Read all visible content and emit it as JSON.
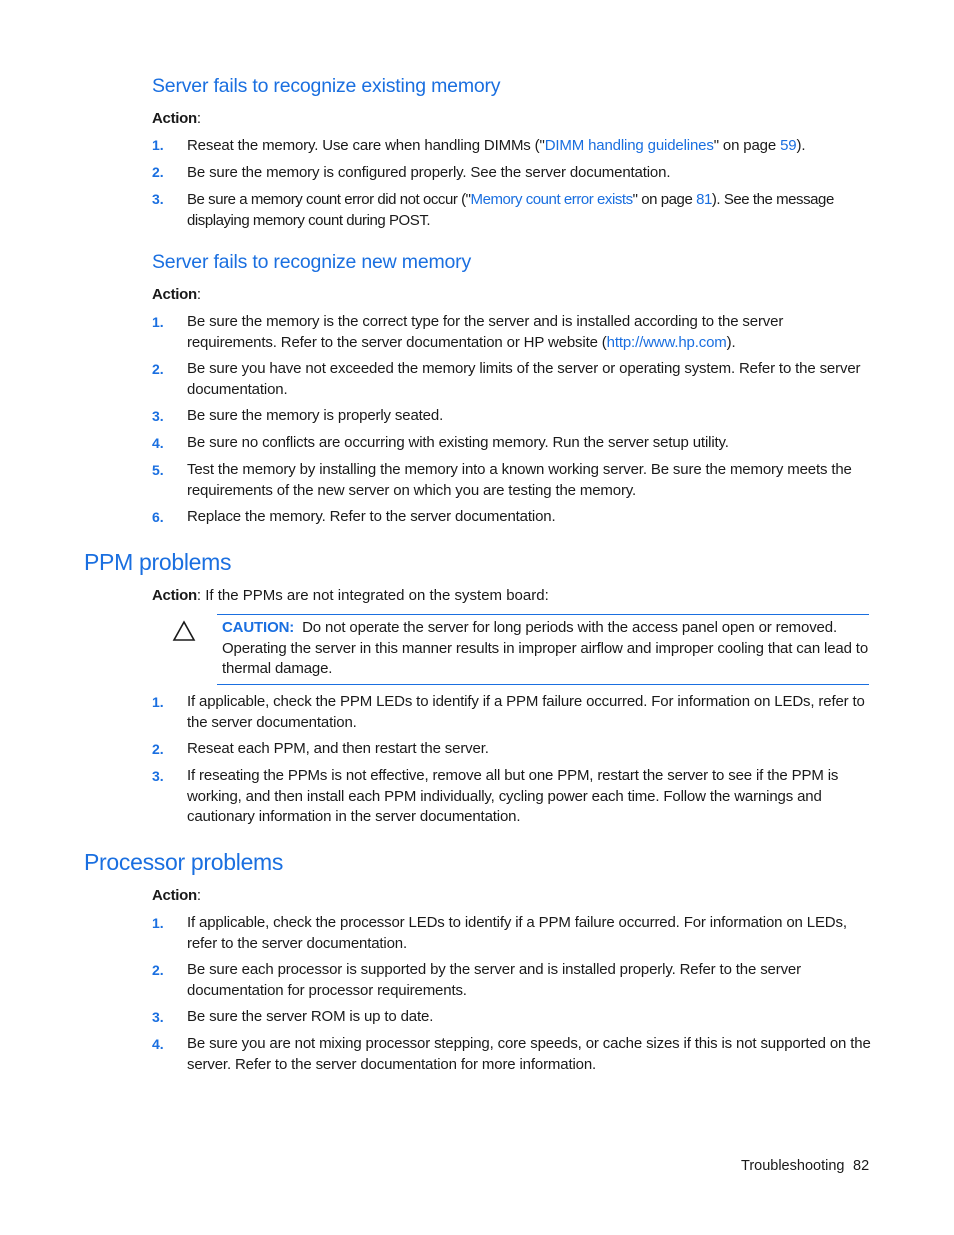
{
  "sections": {
    "existing_memory": {
      "title": "Server fails to recognize existing memory",
      "action_label": "Action",
      "action_suffix": ":",
      "items": [
        {
          "number": "1.",
          "pre": "Reseat the memory. Use care when handling DIMMs (\"",
          "link": "DIMM handling guidelines",
          "mid": "\" on page ",
          "page_link": "59",
          "post": ")."
        },
        {
          "number": "2.",
          "text": "Be sure the memory is configured properly. See the server documentation."
        },
        {
          "number": "3.",
          "pre": "Be sure a memory count error did not occur (\"",
          "link": "Memory count error exists",
          "mid": "\" on page ",
          "page_link": "81",
          "post": "). See the message displaying memory count during POST."
        }
      ]
    },
    "new_memory": {
      "title": "Server fails to recognize new memory",
      "action_label": "Action",
      "action_suffix": ":",
      "items": [
        {
          "number": "1.",
          "pre": "Be sure the memory is the correct type for the server and is installed according to the server requirements. Refer to the server documentation or HP website (",
          "link": "http://www.hp.com",
          "post": ")."
        },
        {
          "number": "2.",
          "text": "Be sure you have not exceeded the memory limits of the server or operating system. Refer to the server documentation."
        },
        {
          "number": "3.",
          "text": "Be sure the memory is properly seated."
        },
        {
          "number": "4.",
          "text": "Be sure no conflicts are occurring with existing memory. Run the server setup utility."
        },
        {
          "number": "5.",
          "text": "Test the memory by installing the memory into a known working server. Be sure the memory meets the requirements of the new server on which you are testing the memory."
        },
        {
          "number": "6.",
          "text": "Replace the memory. Refer to the server documentation."
        }
      ]
    },
    "ppm": {
      "title": "PPM problems",
      "action_label": "Action",
      "action_text": ": If the PPMs are not integrated on the system board:",
      "caution": {
        "icon": "warning-triangle-icon",
        "label": "CAUTION:",
        "text": "Do not operate the server for long periods with the access panel open or removed. Operating the server in this manner results in improper airflow and improper cooling that can lead to thermal damage."
      },
      "items": [
        {
          "number": "1.",
          "text": "If applicable, check the PPM LEDs to identify if a PPM failure occurred. For information on LEDs, refer to the server documentation."
        },
        {
          "number": "2.",
          "text": "Reseat each PPM, and then restart the server."
        },
        {
          "number": "3.",
          "text": "If reseating the PPMs is not effective, remove all but one PPM, restart the server to see if the PPM is working, and then install each PPM individually, cycling power each time. Follow the warnings and cautionary information in the server documentation."
        }
      ]
    },
    "processor": {
      "title": "Processor problems",
      "action_label": "Action",
      "action_suffix": ":",
      "items": [
        {
          "number": "1.",
          "text": "If applicable, check the processor LEDs to identify if a PPM failure occurred. For information on LEDs, refer to the server documentation."
        },
        {
          "number": "2.",
          "text": "Be sure each processor is supported by the server and is installed properly. Refer to the server documentation for processor requirements."
        },
        {
          "number": "3.",
          "text": "Be sure the server ROM is up to date."
        },
        {
          "number": "4.",
          "text": "Be sure you are not mixing processor stepping, core speeds, or cache sizes if this is not supported on the server. Refer to the server documentation for more information."
        }
      ]
    }
  },
  "footer": {
    "section": "Troubleshooting",
    "page_number": "82"
  },
  "colors": {
    "accent": "#1a6fe0",
    "text": "#1a1a1a"
  }
}
